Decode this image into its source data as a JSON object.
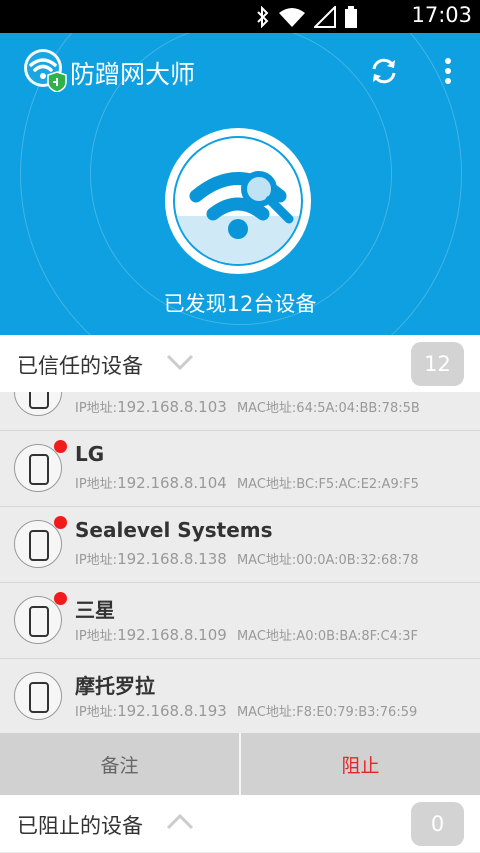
{
  "status_bar": {
    "time": "17:03"
  },
  "header": {
    "app_title": "防蹭网大师",
    "found_text": "已发现12台设备"
  },
  "trusted": {
    "title": "已信任的设备",
    "count": "12"
  },
  "devices": [
    {
      "name": "",
      "ip_label": "IP地址:",
      "ip": "192.168.8.103",
      "mac_label": "MAC地址:",
      "mac": "64:5A:04:BB:78:5B",
      "new": false
    },
    {
      "name": "LG",
      "ip_label": "IP地址:",
      "ip": "192.168.8.104",
      "mac_label": "MAC地址:",
      "mac": "BC:F5:AC:E2:A9:F5",
      "new": true
    },
    {
      "name": "Sealevel Systems",
      "ip_label": "IP地址:",
      "ip": "192.168.8.138",
      "mac_label": "MAC地址:",
      "mac": "00:0A:0B:32:68:78",
      "new": true
    },
    {
      "name": "三星",
      "ip_label": "IP地址:",
      "ip": "192.168.8.109",
      "mac_label": "MAC地址:",
      "mac": "A0:0B:BA:8F:C4:3F",
      "new": true
    },
    {
      "name": "摩托罗拉",
      "ip_label": "IP地址:",
      "ip": "192.168.8.193",
      "mac_label": "MAC地址:",
      "mac": "F8:E0:79:B3:76:59",
      "new": false
    }
  ],
  "actions": {
    "note": "备注",
    "block": "阻止"
  },
  "blocked": {
    "title": "已阻止的设备",
    "count": "0"
  }
}
